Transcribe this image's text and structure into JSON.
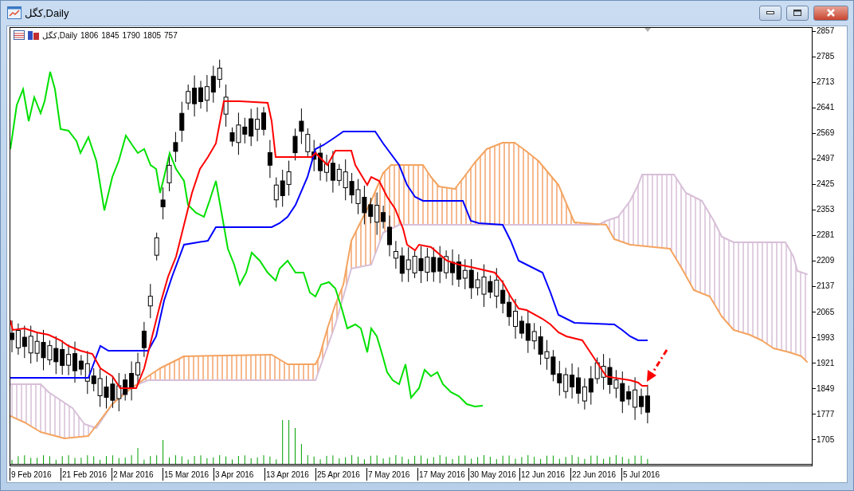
{
  "window": {
    "title": "کگل,Daily"
  },
  "chart": {
    "header": {
      "symbol": "کگل,Daily",
      "values": [
        "1806",
        "1845",
        "1790",
        "1805",
        "757"
      ]
    },
    "price_axis": [
      "2857",
      "2785",
      "2713",
      "2641",
      "2569",
      "2497",
      "2425",
      "2353",
      "2281",
      "2209",
      "2137",
      "2065",
      "1993",
      "1921",
      "1849",
      "1777",
      "1705"
    ],
    "date_axis": [
      "9 Feb 2016",
      "21 Feb 2016",
      "2 Mar 2016",
      "15 Mar 2016",
      "3 Apr 2016",
      "13 Apr 2016",
      "25 Apr 2016",
      "7 May 2016",
      "17 May 2016",
      "30 May 2016",
      "12 Jun 2016",
      "22 Jun 2016",
      "5 Jul 2016"
    ]
  }
}
